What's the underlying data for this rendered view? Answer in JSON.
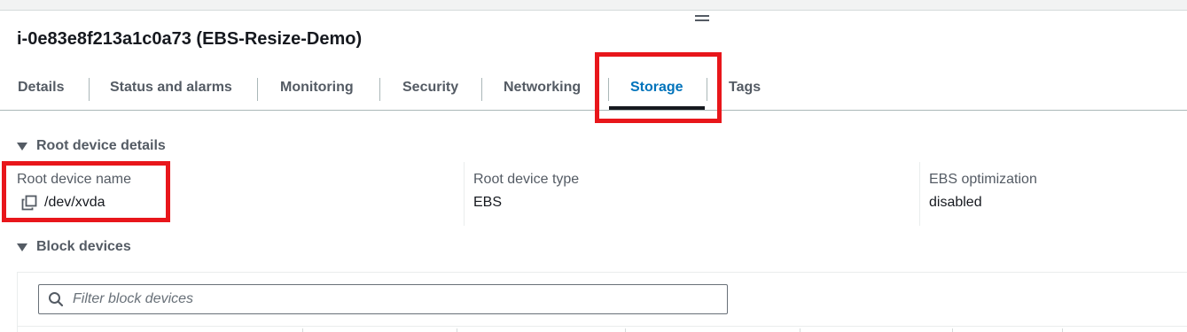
{
  "instance": {
    "title": "i-0e83e8f213a1c0a73 (EBS-Resize-Demo)"
  },
  "tabs": [
    {
      "label": "Details"
    },
    {
      "label": "Status and alarms"
    },
    {
      "label": "Monitoring"
    },
    {
      "label": "Security"
    },
    {
      "label": "Networking"
    },
    {
      "label": "Storage",
      "active": true
    },
    {
      "label": "Tags"
    }
  ],
  "root_device": {
    "header": "Root device details",
    "name_label": "Root device name",
    "name_value": "/dev/xvda",
    "type_label": "Root device type",
    "type_value": "EBS",
    "ebs_opt_label": "EBS optimization",
    "ebs_opt_value": "disabled"
  },
  "block_devices": {
    "header": "Block devices",
    "filter_placeholder": "Filter block devices"
  },
  "colors": {
    "accent": "#0073bb",
    "highlight": "#e8161b",
    "text": "#16191f",
    "muted": "#545b64"
  },
  "icons": [
    "drag-handle-icon",
    "caret-down-icon",
    "copy-icon",
    "search-icon"
  ]
}
